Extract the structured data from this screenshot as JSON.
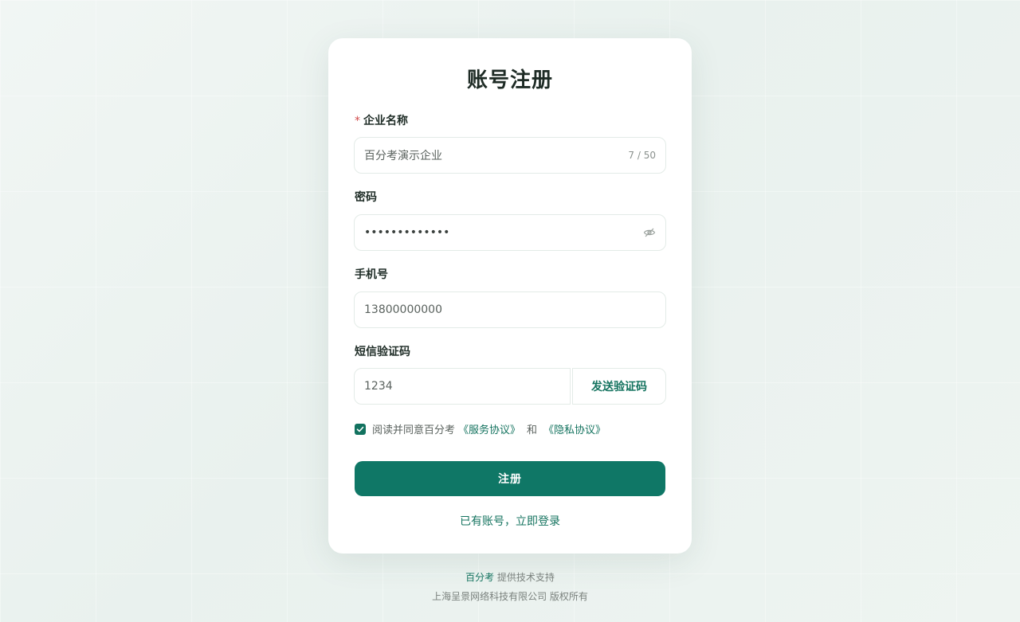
{
  "form": {
    "title": "账号注册",
    "company": {
      "required_mark": "*",
      "label": "企业名称",
      "value": "百分考演示企业",
      "counter": "7 / 50"
    },
    "password": {
      "label": "密码",
      "value": "•••••••••••••",
      "toggle_icon": "eye-off-icon"
    },
    "phone": {
      "label": "手机号",
      "value": "13800000000"
    },
    "sms": {
      "label": "短信验证码",
      "value": "1234",
      "send_label": "发送验证码"
    },
    "agreement": {
      "checked": true,
      "prefix": "阅读并同意百分考",
      "service_link": "《服务协议》",
      "and": "和",
      "privacy_link": "《隐私协议》"
    },
    "submit_label": "注册",
    "login_link": "已有账号，立即登录"
  },
  "footer": {
    "brand": "百分考",
    "support": "提供技术支持",
    "copyright": "上海呈景网络科技有限公司 版权所有"
  },
  "colors": {
    "accent": "#0f7766",
    "link": "#14735f",
    "required": "#d14b4b"
  }
}
